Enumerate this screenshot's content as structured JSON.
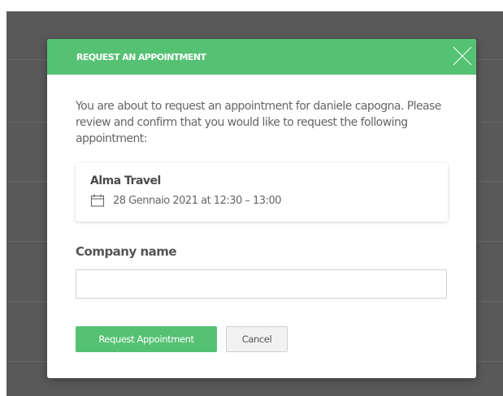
{
  "modal": {
    "title": "REQUEST AN APPOINTMENT",
    "close_icon": "close-icon",
    "intro": "You are about to request an appointment for daniele capogna. Please review and confirm that you would like to request the following appointment:",
    "appointment": {
      "company": "Alma Travel",
      "icon": "calendar-icon",
      "datetime": "28 Gennaio 2021 at 12:30 – 13:00"
    },
    "company_field": {
      "label": "Company name",
      "value": "",
      "placeholder": ""
    },
    "buttons": {
      "submit": "Request Appointment",
      "cancel": "Cancel"
    }
  },
  "colors": {
    "accent": "#55c173",
    "backdrop": "#595959",
    "text": "#666666"
  }
}
